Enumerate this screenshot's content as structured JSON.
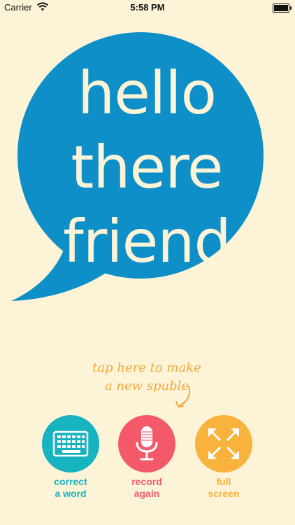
{
  "status_bar": {
    "carrier": "Carrier",
    "time": "5:58 PM"
  },
  "bubble": {
    "lines": [
      "hello",
      "there",
      "friend"
    ],
    "color": "#0f8fc8"
  },
  "hint": {
    "line1": "tap here to make",
    "line2": "a new spuble"
  },
  "actions": [
    {
      "line1": "correct",
      "line2": "a word",
      "icon": "keyboard-icon",
      "color": "#17b3c1"
    },
    {
      "line1": "record",
      "line2": "again",
      "icon": "microphone-icon",
      "color": "#f4596a"
    },
    {
      "line1": "full",
      "line2": "screen",
      "icon": "expand-icon",
      "color": "#f9b23c"
    }
  ],
  "colors": {
    "background": "#fdf4d8",
    "hint": "#f2a93c"
  }
}
